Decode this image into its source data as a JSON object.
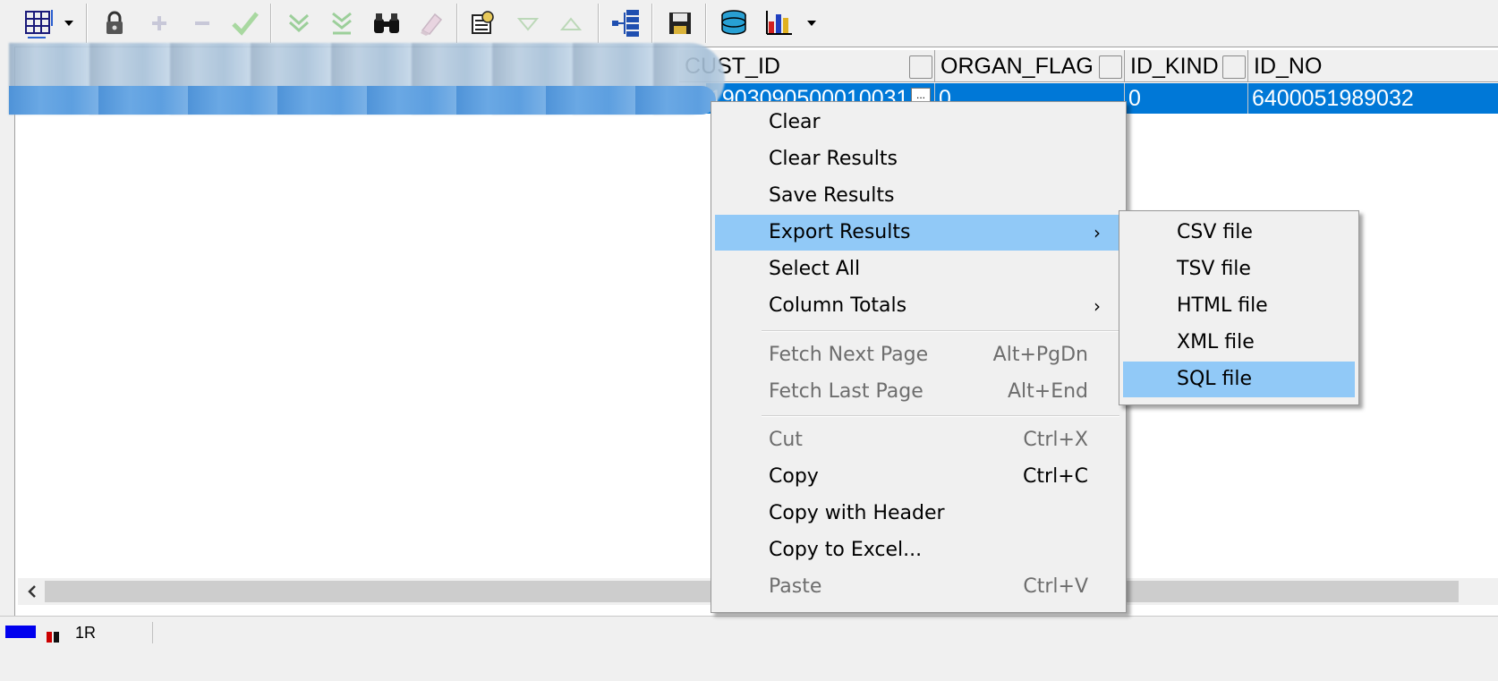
{
  "toolbar": {
    "icons": [
      "grid-layout-icon",
      "dropdown-arrow-icon",
      "lock-icon",
      "add-record-icon",
      "delete-record-icon",
      "post-changes-icon",
      "fetch-next-icon",
      "fetch-last-icon",
      "find-icon",
      "clear-icon",
      "query-by-example-icon",
      "next-query-icon",
      "previous-query-icon",
      "explain-plan-icon",
      "save-icon",
      "export-db-icon",
      "chart-icon",
      "chart-dropdown-icon"
    ]
  },
  "grid": {
    "columns": [
      {
        "label": "CUST_ID"
      },
      {
        "label": "ORGAN_FLAG"
      },
      {
        "label": "ID_KIND"
      },
      {
        "label": "ID_NO"
      }
    ],
    "rows": [
      [
        "1903090500010031",
        "0",
        "0",
        "6400051989032"
      ]
    ],
    "cell_button": "..."
  },
  "status": {
    "text": "1R"
  },
  "context_menu": {
    "items": [
      {
        "label": "Clear",
        "shortcut": "",
        "disabled": false
      },
      {
        "label": "Clear Results",
        "shortcut": "",
        "disabled": false
      },
      {
        "label": "Save Results",
        "shortcut": "",
        "disabled": false
      },
      {
        "label": "Export Results",
        "shortcut": "",
        "submenu": true,
        "highlighted": true
      },
      {
        "label": "Select All",
        "shortcut": "",
        "disabled": false
      },
      {
        "label": "Column Totals",
        "shortcut": "",
        "submenu": true
      },
      {
        "label": "Fetch Next Page",
        "shortcut": "Alt+PgDn",
        "disabled": true
      },
      {
        "label": "Fetch Last Page",
        "shortcut": "Alt+End",
        "disabled": true
      },
      {
        "label": "Cut",
        "shortcut": "Ctrl+X",
        "disabled": true
      },
      {
        "label": "Copy",
        "shortcut": "Ctrl+C",
        "disabled": false
      },
      {
        "label": "Copy with Header",
        "shortcut": "",
        "disabled": false
      },
      {
        "label": "Copy to Excel...",
        "shortcut": "",
        "disabled": false
      },
      {
        "label": "Paste",
        "shortcut": "Ctrl+V",
        "disabled": true
      }
    ],
    "submenu_arrow": "›"
  },
  "export_submenu": {
    "items": [
      {
        "label": "CSV file"
      },
      {
        "label": "TSV file"
      },
      {
        "label": "HTML file"
      },
      {
        "label": "XML file"
      },
      {
        "label": "SQL file",
        "highlighted": true
      }
    ]
  },
  "colors": {
    "selection": "#0078d7",
    "menu_highlight": "#91c9f7",
    "menu_bg": "#f0f0f0"
  }
}
